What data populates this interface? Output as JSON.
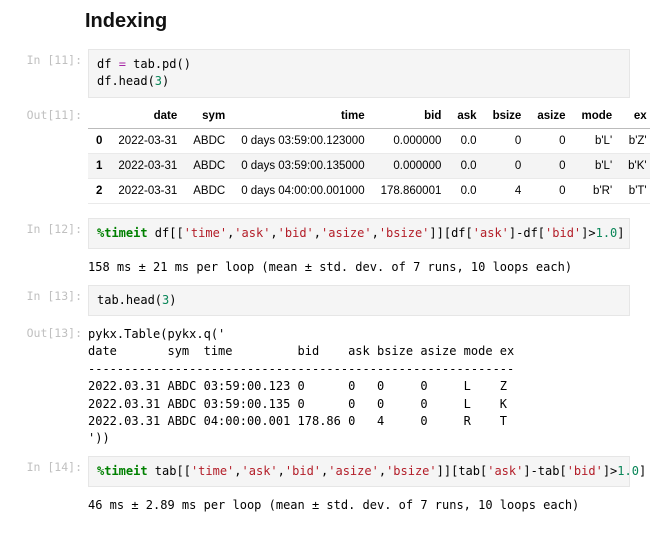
{
  "heading": "Indexing",
  "cells": {
    "c11": {
      "prompt": "In [11]:",
      "code_line1_a": "df ",
      "code_line1_eq": "= ",
      "code_line1_b": "tab.pd()",
      "code_line2_a": "df.head(",
      "code_line2_n": "3",
      "code_line2_b": ")"
    },
    "out11": {
      "prompt": "Out[11]:"
    },
    "c12": {
      "prompt": "In [12]:",
      "mgc": "%timeit",
      "sp": " df[[",
      "s0": "'time'",
      "c0": ",",
      "s1": "'ask'",
      "c1": ",",
      "s2": "'bid'",
      "c2": ",",
      "s3": "'asize'",
      "c3": ",",
      "s4": "'bsize'",
      "mid": "]][df[",
      "s5": "'ask'",
      "mid2": "]-df[",
      "s6": "'bid'",
      "tail": "]>",
      "num": "1.0",
      "end": "]",
      "result": "158 ms ± 21 ms per loop (mean ± std. dev. of 7 runs, 10 loops each)"
    },
    "c13": {
      "prompt": "In [13]:",
      "code_a": "tab.head(",
      "code_n": "3",
      "code_b": ")"
    },
    "out13": {
      "prompt": "Out[13]:",
      "text": "pykx.Table(pykx.q('\ndate       sym  time         bid    ask bsize asize mode ex\n-----------------------------------------------------------\n2022.03.31 ABDC 03:59:00.123 0      0   0     0     L    Z \n2022.03.31 ABDC 03:59:00.135 0      0   0     0     L    K \n2022.03.31 ABDC 04:00:00.001 178.86 0   4     0     R    T \n'))"
    },
    "c14": {
      "prompt": "In [14]:",
      "mgc": "%timeit",
      "sp": " tab[[",
      "s0": "'time'",
      "c0": ",",
      "s1": "'ask'",
      "c1": ",",
      "s2": "'bid'",
      "c2": ",",
      "s3": "'asize'",
      "c3": ",",
      "s4": "'bsize'",
      "mid": "]][tab[",
      "s5": "'ask'",
      "mid2": "]-tab[",
      "s6": "'bid'",
      "tail": "]>",
      "num": "1.0",
      "end": "]",
      "result": "46 ms ± 2.89 ms per loop (mean ± std. dev. of 7 runs, 10 loops each)"
    }
  },
  "dataframe": {
    "columns": [
      "date",
      "sym",
      "time",
      "bid",
      "ask",
      "bsize",
      "asize",
      "mode",
      "ex"
    ],
    "rows": [
      {
        "idx": "0",
        "date": "2022-03-31",
        "sym": "ABDC",
        "time": "0 days 03:59:00.123000",
        "bid": "0.000000",
        "ask": "0.0",
        "bsize": "0",
        "asize": "0",
        "mode": "b'L'",
        "ex": "b'Z'"
      },
      {
        "idx": "1",
        "date": "2022-03-31",
        "sym": "ABDC",
        "time": "0 days 03:59:00.135000",
        "bid": "0.000000",
        "ask": "0.0",
        "bsize": "0",
        "asize": "0",
        "mode": "b'L'",
        "ex": "b'K'"
      },
      {
        "idx": "2",
        "date": "2022-03-31",
        "sym": "ABDC",
        "time": "0 days 04:00:00.001000",
        "bid": "178.860001",
        "ask": "0.0",
        "bsize": "4",
        "asize": "0",
        "mode": "b'R'",
        "ex": "b'T'"
      }
    ]
  }
}
